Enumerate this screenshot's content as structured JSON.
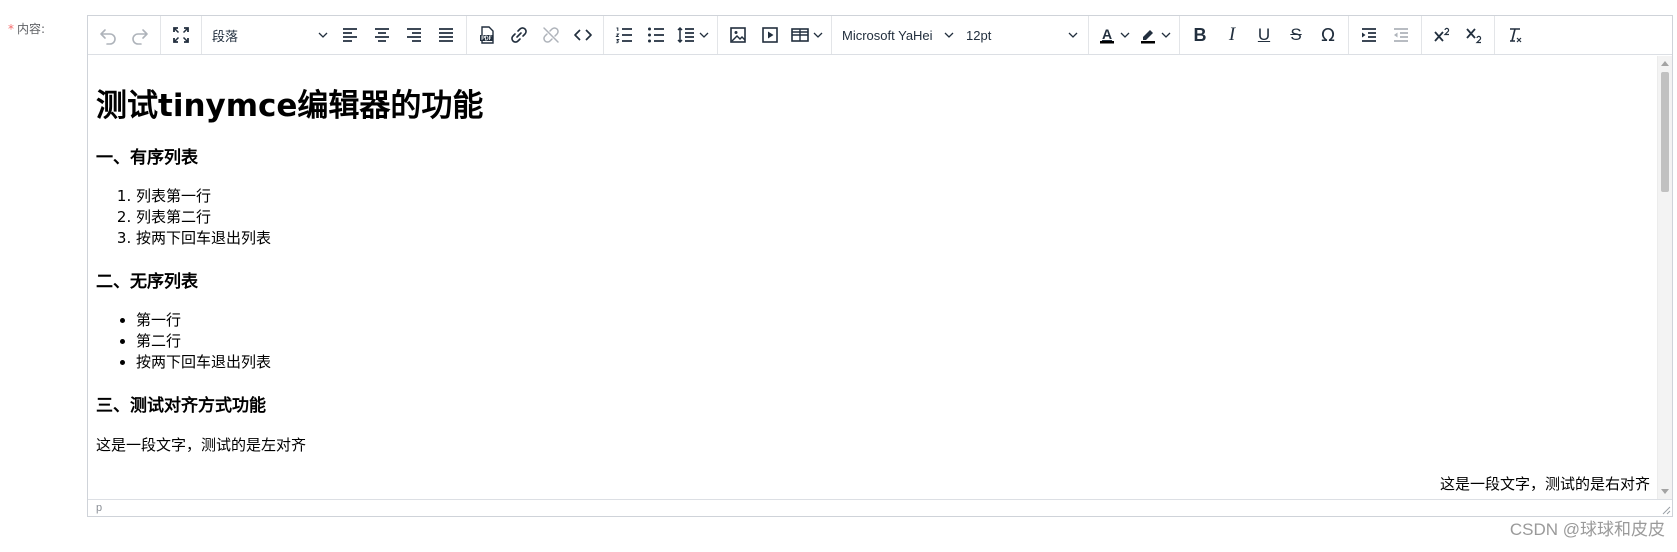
{
  "form": {
    "required_mark": "*",
    "label": "内容:"
  },
  "toolbar": {
    "block_format": "段落",
    "font_family": "Microsoft YaHei",
    "font_size": "12pt",
    "text_color_icon": "A",
    "bold": "B",
    "italic": "I",
    "underline": "U",
    "strike": "S",
    "special_char": "Ω"
  },
  "content": {
    "title": "测试tinymce编辑器的功能",
    "section1": {
      "heading": "一、有序列表",
      "items": [
        "列表第一行",
        "列表第二行",
        "按两下回车退出列表"
      ]
    },
    "section2": {
      "heading": "二、无序列表",
      "items": [
        "第一行",
        "第二行",
        "按两下回车退出列表"
      ]
    },
    "section3": {
      "heading": "三、测试对齐方式功能",
      "left_text": "这是一段文字，测试的是左对齐",
      "right_text": "这是一段文字，测试的是右对齐"
    }
  },
  "statusbar": {
    "path": "p"
  },
  "watermark": "CSDN @球球和皮皮"
}
